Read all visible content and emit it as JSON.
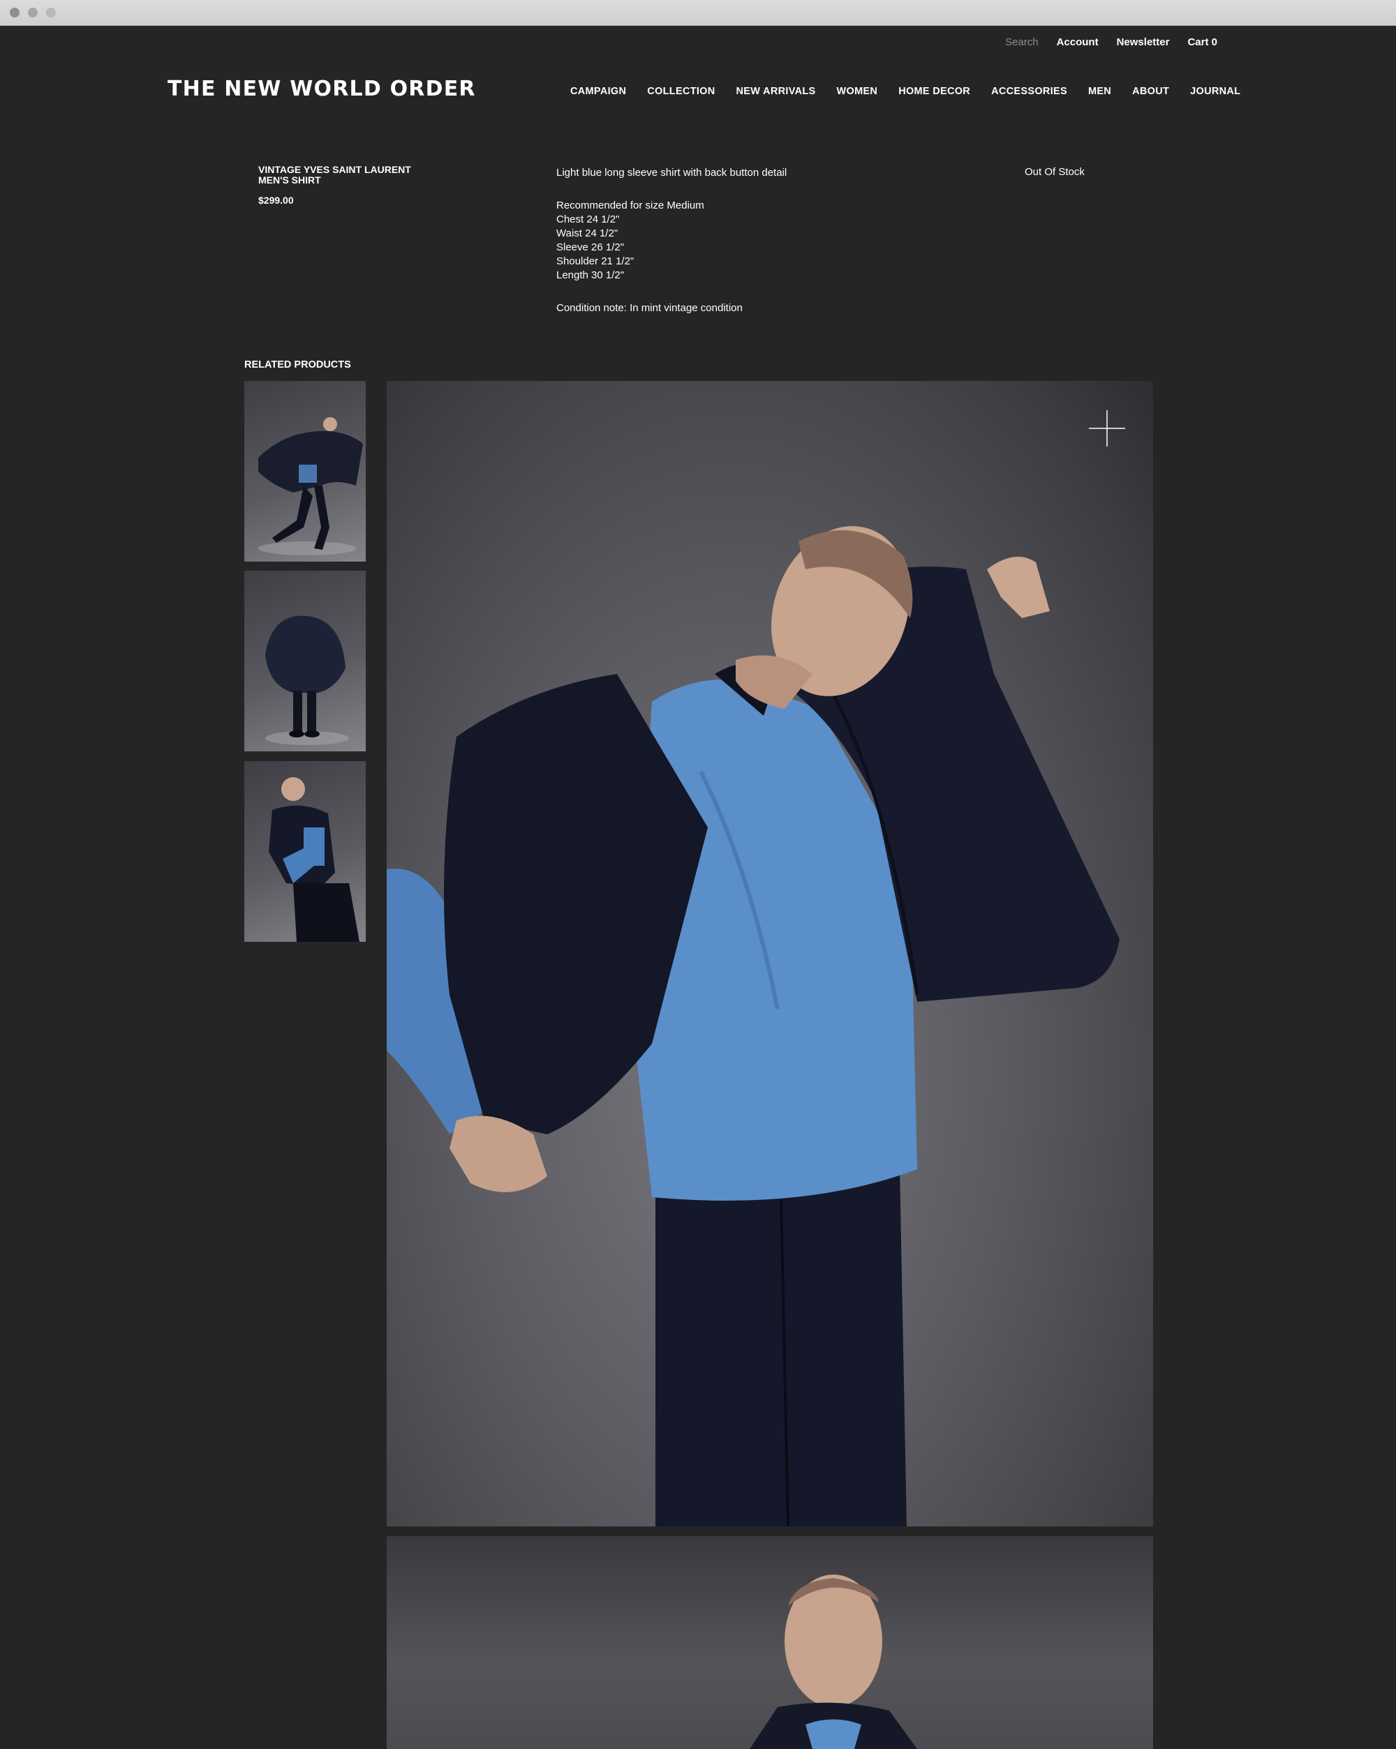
{
  "utility_nav": {
    "search": "Search",
    "account": "Account",
    "newsletter": "Newsletter",
    "cart": "Cart 0"
  },
  "brand": {
    "logo_text": "THE NEW WORLD ORDER"
  },
  "main_nav": [
    "CAMPAIGN",
    "COLLECTION",
    "NEW ARRIVALS",
    "WOMEN",
    "HOME DECOR",
    "ACCESSORIES",
    "MEN",
    "ABOUT",
    "JOURNAL"
  ],
  "product": {
    "title": "VINTAGE YVES SAINT LAURENT MEN'S SHIRT",
    "price": "$299.00",
    "description": "Light blue long sleeve shirt with back button detail",
    "measurements": [
      "Recommended for size Medium",
      "Chest 24 1/2\"",
      "Waist 24 1/2\"",
      "Sleeve 26 1/2\"",
      "Shoulder 21 1/2\"",
      "Length 30 1/2\""
    ],
    "condition": "Condition note: In mint vintage condition",
    "stock_status": "Out Of Stock"
  },
  "related": {
    "title": "RELATED PRODUCTS"
  },
  "icons": {
    "zoom": "plus-icon"
  },
  "colors": {
    "background": "#252526",
    "shirt_blue": "#5b8fc9",
    "jacket_navy": "#141828"
  }
}
